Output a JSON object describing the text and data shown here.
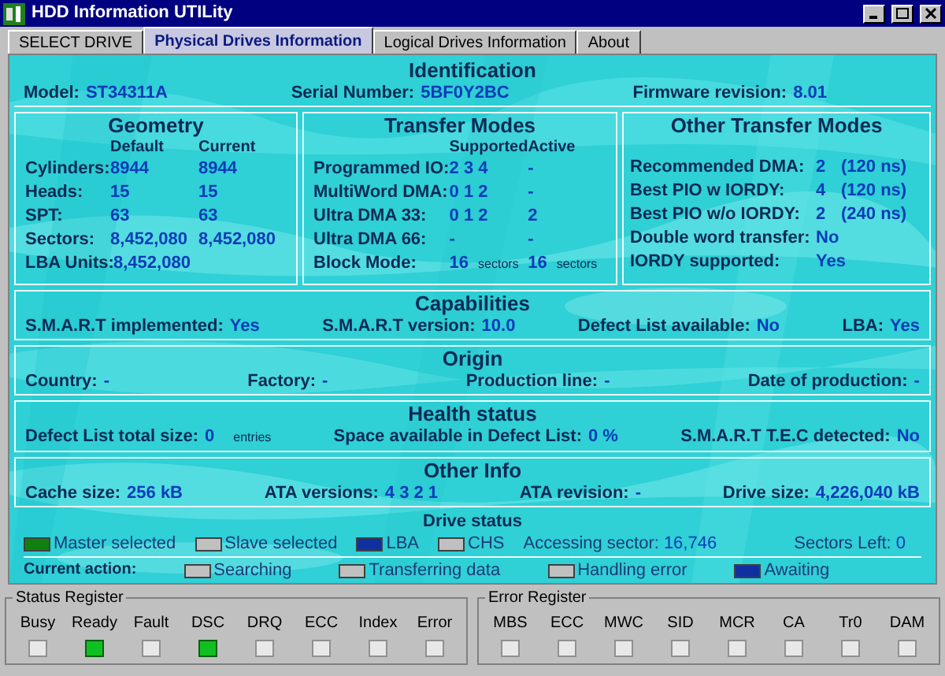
{
  "window": {
    "title": "HDD Information UTILity"
  },
  "tabs": [
    {
      "label": "SELECT DRIVE",
      "selected": false
    },
    {
      "label": "Physical Drives Information",
      "selected": true
    },
    {
      "label": "Logical Drives Information",
      "selected": false
    },
    {
      "label": "About",
      "selected": false
    }
  ],
  "identification": {
    "title": "Identification",
    "fields": [
      {
        "label": "Model:",
        "value": "ST34311A"
      },
      {
        "label": "Serial Number:",
        "value": "5BF0Y2BC"
      },
      {
        "label": "Firmware revision:",
        "value": "8.01"
      }
    ]
  },
  "geometry": {
    "title": "Geometry",
    "columns": [
      "Default",
      "Current"
    ],
    "rows": [
      {
        "label": "Cylinders:",
        "values": [
          "8944",
          "8944"
        ]
      },
      {
        "label": "Heads:",
        "values": [
          "15",
          "15"
        ]
      },
      {
        "label": "SPT:",
        "values": [
          "63",
          "63"
        ]
      },
      {
        "label": "Sectors:",
        "values": [
          "8,452,080",
          "8,452,080"
        ]
      },
      {
        "label": "LBA Units:",
        "values": [
          "8,452,080"
        ]
      }
    ]
  },
  "transfer_modes": {
    "title": "Transfer Modes",
    "columns": [
      "Supported",
      "Active"
    ],
    "rows": [
      {
        "label": "Programmed IO:",
        "values": [
          "2 3 4",
          "-"
        ]
      },
      {
        "label": "MultiWord DMA:",
        "values": [
          "0 1 2",
          "-"
        ]
      },
      {
        "label": "Ultra DMA 33:",
        "values": [
          "0 1 2",
          "2"
        ]
      },
      {
        "label": "Ultra DMA 66:",
        "values": [
          "-",
          "-"
        ]
      },
      {
        "label": "Block Mode:",
        "values": [
          "16",
          "16"
        ],
        "units": [
          "sectors",
          "sectors"
        ]
      }
    ]
  },
  "other_transfer_modes": {
    "title": "Other Transfer Modes",
    "rows": [
      {
        "label": "Recommended DMA:",
        "value": "2",
        "note": "(120 ns)"
      },
      {
        "label": "Best PIO w IORDY:",
        "value": "4",
        "note": "(120 ns)"
      },
      {
        "label": "Best PIO w/o IORDY:",
        "value": "2",
        "note": "(240 ns)"
      },
      {
        "label": "Double word transfer:",
        "value": "No"
      },
      {
        "label": "IORDY supported:",
        "value": "Yes"
      }
    ]
  },
  "capabilities": {
    "title": "Capabilities",
    "fields": [
      {
        "label": "S.M.A.R.T implemented:",
        "value": "Yes"
      },
      {
        "label": "S.M.A.R.T version:",
        "value": "10.0"
      },
      {
        "label": "Defect List available:",
        "value": "No"
      },
      {
        "label": "LBA:",
        "value": "Yes"
      }
    ]
  },
  "origin": {
    "title": "Origin",
    "fields": [
      {
        "label": "Country:",
        "value": "-"
      },
      {
        "label": "Factory:",
        "value": "-"
      },
      {
        "label": "Production line:",
        "value": "-"
      },
      {
        "label": "Date of production:",
        "value": "-"
      }
    ]
  },
  "health_status": {
    "title": "Health status",
    "fields": [
      {
        "label": "Defect List total size:",
        "value": "0",
        "unit": "entries"
      },
      {
        "label": "Space available in Defect List:",
        "value": "0 %"
      },
      {
        "label": "S.M.A.R.T T.E.C detected:",
        "value": "No"
      }
    ]
  },
  "other_info": {
    "title": "Other Info",
    "fields": [
      {
        "label": "Cache size:",
        "value": "256 kB"
      },
      {
        "label": "ATA versions:",
        "value": "4 3 2 1"
      },
      {
        "label": "ATA revision:",
        "value": "-"
      },
      {
        "label": "Drive size:",
        "value": "4,226,040 kB"
      }
    ]
  },
  "drive_status": {
    "title": "Drive status",
    "indicators": [
      {
        "label": "Master selected",
        "color": "#108010"
      },
      {
        "label": "Slave selected",
        "color": "#c0c0c0"
      },
      {
        "label": "LBA",
        "color": "#1030a0"
      },
      {
        "label": "CHS",
        "color": "#c0c0c0"
      }
    ],
    "accessing": {
      "label": "Accessing sector:",
      "value": "16,746"
    },
    "sectors_left": {
      "label": "Sectors Left:",
      "value": "0"
    }
  },
  "current_action": {
    "label": "Current action:",
    "indicators": [
      {
        "label": "Searching",
        "color": "#c0c0c0"
      },
      {
        "label": "Transferring data",
        "color": "#c0c0c0"
      },
      {
        "label": "Handling error",
        "color": "#c0c0c0"
      },
      {
        "label": "Awaiting",
        "color": "#1030a0"
      }
    ]
  },
  "status_register": {
    "title": "Status Register",
    "bits": [
      {
        "label": "Busy",
        "on": false
      },
      {
        "label": "Ready",
        "on": true
      },
      {
        "label": "Fault",
        "on": false
      },
      {
        "label": "DSC",
        "on": true
      },
      {
        "label": "DRQ",
        "on": false
      },
      {
        "label": "ECC",
        "on": false
      },
      {
        "label": "Index",
        "on": false
      },
      {
        "label": "Error",
        "on": false
      }
    ]
  },
  "error_register": {
    "title": "Error Register",
    "bits": [
      {
        "label": "MBS",
        "on": false
      },
      {
        "label": "ECC",
        "on": false
      },
      {
        "label": "MWC",
        "on": false
      },
      {
        "label": "SID",
        "on": false
      },
      {
        "label": "MCR",
        "on": false
      },
      {
        "label": "CA",
        "on": false
      },
      {
        "label": "Tr0",
        "on": false
      },
      {
        "label": "DAM",
        "on": false
      }
    ]
  }
}
